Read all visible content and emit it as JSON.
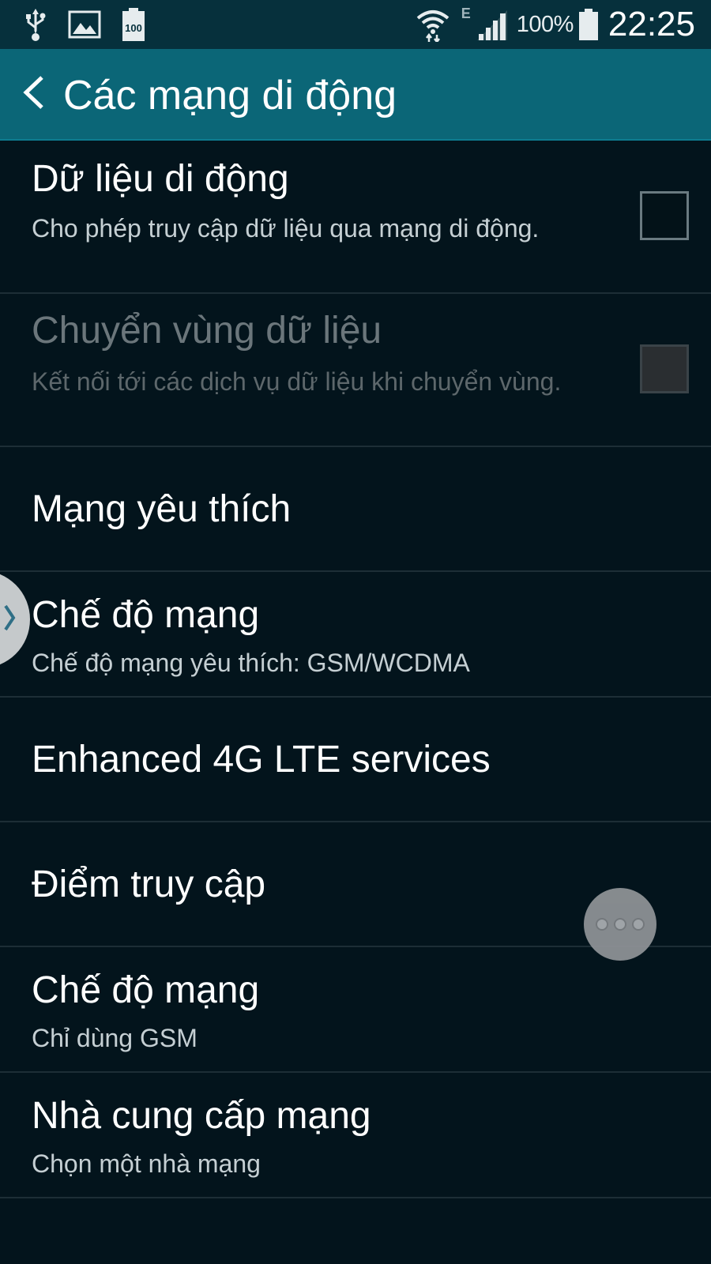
{
  "status_bar": {
    "battery_percent": "100%",
    "time": "22:25",
    "network_type": "E",
    "battery_icon_label": "100",
    "icons": [
      "usb-icon",
      "image-icon",
      "battery-saver-icon",
      "wifi-icon",
      "signal-icon",
      "battery-icon"
    ]
  },
  "app_bar": {
    "title": "Các mạng di động",
    "back_icon": "chevron-left-icon"
  },
  "settings": {
    "mobile_data": {
      "title": "Dữ liệu di động",
      "summary": "Cho phép truy cập dữ liệu qua mạng di động.",
      "checked": false
    },
    "data_roaming": {
      "title": "Chuyển vùng dữ liệu",
      "summary": "Kết nối tới các dịch vụ dữ liệu khi chuyển vùng.",
      "checked": false,
      "enabled": false
    },
    "preferred_networks": {
      "title": "Mạng yêu thích"
    },
    "network_mode": {
      "title": "Chế độ mạng",
      "summary": "Chế độ mạng yêu thích: GSM/WCDMA"
    },
    "enhanced_lte": {
      "title": "Enhanced 4G LTE services"
    },
    "access_point": {
      "title": "Điểm truy cập"
    },
    "network_mode_2": {
      "title": "Chế độ mạng",
      "summary": "Chỉ dùng GSM"
    },
    "network_operator": {
      "title": "Nhà cung cấp mạng",
      "summary": "Chọn một nhà mạng"
    }
  },
  "colors": {
    "status_bar_bg": "#06303c",
    "app_bar_bg": "#0b6677",
    "list_bg": "#03141c",
    "divider": "#1d2e36"
  }
}
